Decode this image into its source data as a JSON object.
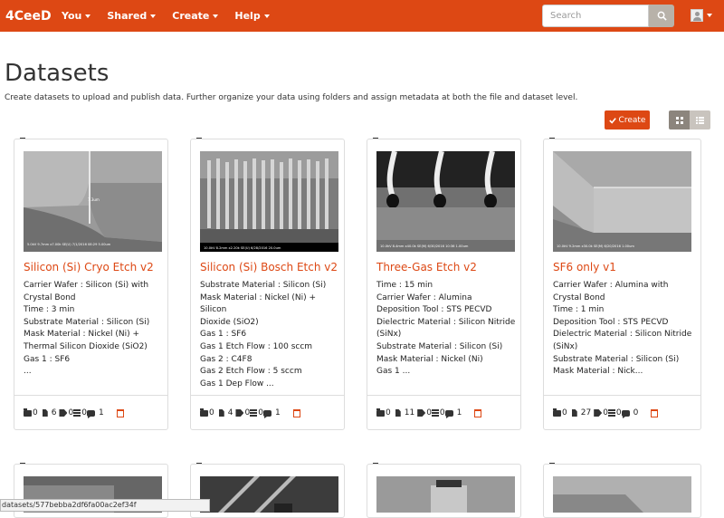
{
  "navbar": {
    "brand": "4CeeD",
    "menus": [
      "You",
      "Shared",
      "Create",
      "Help"
    ],
    "search_placeholder": "Search",
    "accent": "#dd4814"
  },
  "header": {
    "title": "Datasets",
    "description": "Create datasets to upload and publish data. Further organize your data using folders and assign metadata at both the file and dataset level."
  },
  "toolbar": {
    "create_label": "Create",
    "create_icon": "checkmark-icon",
    "view_modes": [
      "grid-view-icon",
      "list-view-icon"
    ]
  },
  "datasets": [
    {
      "title": "Silicon (Si) Cryo Etch v2",
      "description": "Carrier Wafer : Silicon (Si) with Crystal Bond\nTime : 3 min\nSubstrate Material : Silicon (Si)\nMask Material : Nickel (Ni) + Thermal Silicon Dioxide (SiO2)\nGas 1 : SF6\n...",
      "folders": "0",
      "files": "6",
      "tags": "0",
      "metadata": "0",
      "comments": "1",
      "sem_caption": "5.0kV 9.7mm x7.00k SE(U) 7/1/2016 08:29                 5.00um"
    },
    {
      "title": "Silicon (Si) Bosch Etch v2",
      "description": "Substrate Material : Silicon (Si)\nMask Material : Nickel (Ni) + Silicon Dioxide (SiO2)\nGas 1 : SF6\nGas 1 Etch Flow : 100 sccm\nGas 2 : C4F8\nGas 2 Etch Flow : 5 sccm\nGas 1 Dep Flow ...",
      "folders": "0",
      "files": "4",
      "tags": "0",
      "metadata": "0",
      "comments": "1",
      "sem_caption": "10.0kV 8.2mm x2.20k SE(U) 6/28/2016                  20.0um"
    },
    {
      "title": "Three-Gas Etch v2",
      "description": "Time : 15 min\nCarrier Wafer : Alumina\nDeposition Tool : STS PECVD\nDielectric Material : Silicon Nitride (SiNx)\nSubstrate Material : Silicon (Si)\nMask Material : Nickel (Ni)\nGas 1 ...",
      "folders": "0",
      "files": "11",
      "tags": "0",
      "metadata": "0",
      "comments": "1",
      "sem_caption": "10.0kV 8.4mm x40.0k SE(M) 6/30/2016 10:36               1.00um"
    },
    {
      "title": "SF6 only v1",
      "description": "Carrier Wafer : Alumina with Crystal Bond\nTime : 1 min\nDeposition Tool : STS PECVD\nDielectric Material : Silicon Nitride (SiNx)\nSubstrate Material : Silicon (Si)\nMask Material : Nick...",
      "folders": "0",
      "files": "27",
      "tags": "0",
      "metadata": "0",
      "comments": "0",
      "sem_caption": "10.0kV 9.2mm x30.0k SE(M) 6/20/2016                  1.00um"
    }
  ],
  "status_url": "datasets/577bebba2df6fa00ac2ef34f"
}
